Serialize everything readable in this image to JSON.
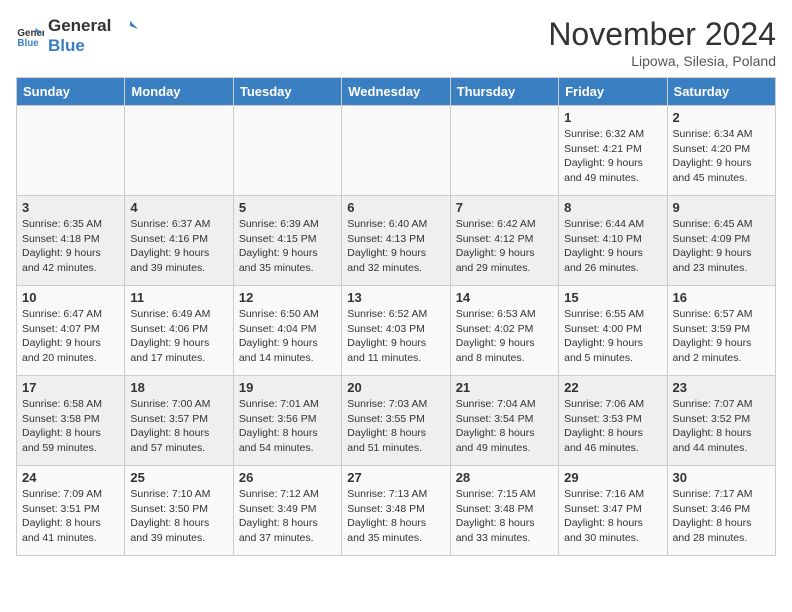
{
  "header": {
    "logo_general": "General",
    "logo_blue": "Blue",
    "month": "November 2024",
    "location": "Lipowa, Silesia, Poland"
  },
  "days_of_week": [
    "Sunday",
    "Monday",
    "Tuesday",
    "Wednesday",
    "Thursday",
    "Friday",
    "Saturday"
  ],
  "weeks": [
    [
      {
        "day": "",
        "info": ""
      },
      {
        "day": "",
        "info": ""
      },
      {
        "day": "",
        "info": ""
      },
      {
        "day": "",
        "info": ""
      },
      {
        "day": "",
        "info": ""
      },
      {
        "day": "1",
        "info": "Sunrise: 6:32 AM\nSunset: 4:21 PM\nDaylight: 9 hours and 49 minutes."
      },
      {
        "day": "2",
        "info": "Sunrise: 6:34 AM\nSunset: 4:20 PM\nDaylight: 9 hours and 45 minutes."
      }
    ],
    [
      {
        "day": "3",
        "info": "Sunrise: 6:35 AM\nSunset: 4:18 PM\nDaylight: 9 hours and 42 minutes."
      },
      {
        "day": "4",
        "info": "Sunrise: 6:37 AM\nSunset: 4:16 PM\nDaylight: 9 hours and 39 minutes."
      },
      {
        "day": "5",
        "info": "Sunrise: 6:39 AM\nSunset: 4:15 PM\nDaylight: 9 hours and 35 minutes."
      },
      {
        "day": "6",
        "info": "Sunrise: 6:40 AM\nSunset: 4:13 PM\nDaylight: 9 hours and 32 minutes."
      },
      {
        "day": "7",
        "info": "Sunrise: 6:42 AM\nSunset: 4:12 PM\nDaylight: 9 hours and 29 minutes."
      },
      {
        "day": "8",
        "info": "Sunrise: 6:44 AM\nSunset: 4:10 PM\nDaylight: 9 hours and 26 minutes."
      },
      {
        "day": "9",
        "info": "Sunrise: 6:45 AM\nSunset: 4:09 PM\nDaylight: 9 hours and 23 minutes."
      }
    ],
    [
      {
        "day": "10",
        "info": "Sunrise: 6:47 AM\nSunset: 4:07 PM\nDaylight: 9 hours and 20 minutes."
      },
      {
        "day": "11",
        "info": "Sunrise: 6:49 AM\nSunset: 4:06 PM\nDaylight: 9 hours and 17 minutes."
      },
      {
        "day": "12",
        "info": "Sunrise: 6:50 AM\nSunset: 4:04 PM\nDaylight: 9 hours and 14 minutes."
      },
      {
        "day": "13",
        "info": "Sunrise: 6:52 AM\nSunset: 4:03 PM\nDaylight: 9 hours and 11 minutes."
      },
      {
        "day": "14",
        "info": "Sunrise: 6:53 AM\nSunset: 4:02 PM\nDaylight: 9 hours and 8 minutes."
      },
      {
        "day": "15",
        "info": "Sunrise: 6:55 AM\nSunset: 4:00 PM\nDaylight: 9 hours and 5 minutes."
      },
      {
        "day": "16",
        "info": "Sunrise: 6:57 AM\nSunset: 3:59 PM\nDaylight: 9 hours and 2 minutes."
      }
    ],
    [
      {
        "day": "17",
        "info": "Sunrise: 6:58 AM\nSunset: 3:58 PM\nDaylight: 8 hours and 59 minutes."
      },
      {
        "day": "18",
        "info": "Sunrise: 7:00 AM\nSunset: 3:57 PM\nDaylight: 8 hours and 57 minutes."
      },
      {
        "day": "19",
        "info": "Sunrise: 7:01 AM\nSunset: 3:56 PM\nDaylight: 8 hours and 54 minutes."
      },
      {
        "day": "20",
        "info": "Sunrise: 7:03 AM\nSunset: 3:55 PM\nDaylight: 8 hours and 51 minutes."
      },
      {
        "day": "21",
        "info": "Sunrise: 7:04 AM\nSunset: 3:54 PM\nDaylight: 8 hours and 49 minutes."
      },
      {
        "day": "22",
        "info": "Sunrise: 7:06 AM\nSunset: 3:53 PM\nDaylight: 8 hours and 46 minutes."
      },
      {
        "day": "23",
        "info": "Sunrise: 7:07 AM\nSunset: 3:52 PM\nDaylight: 8 hours and 44 minutes."
      }
    ],
    [
      {
        "day": "24",
        "info": "Sunrise: 7:09 AM\nSunset: 3:51 PM\nDaylight: 8 hours and 41 minutes."
      },
      {
        "day": "25",
        "info": "Sunrise: 7:10 AM\nSunset: 3:50 PM\nDaylight: 8 hours and 39 minutes."
      },
      {
        "day": "26",
        "info": "Sunrise: 7:12 AM\nSunset: 3:49 PM\nDaylight: 8 hours and 37 minutes."
      },
      {
        "day": "27",
        "info": "Sunrise: 7:13 AM\nSunset: 3:48 PM\nDaylight: 8 hours and 35 minutes."
      },
      {
        "day": "28",
        "info": "Sunrise: 7:15 AM\nSunset: 3:48 PM\nDaylight: 8 hours and 33 minutes."
      },
      {
        "day": "29",
        "info": "Sunrise: 7:16 AM\nSunset: 3:47 PM\nDaylight: 8 hours and 30 minutes."
      },
      {
        "day": "30",
        "info": "Sunrise: 7:17 AM\nSunset: 3:46 PM\nDaylight: 8 hours and 28 minutes."
      }
    ]
  ]
}
